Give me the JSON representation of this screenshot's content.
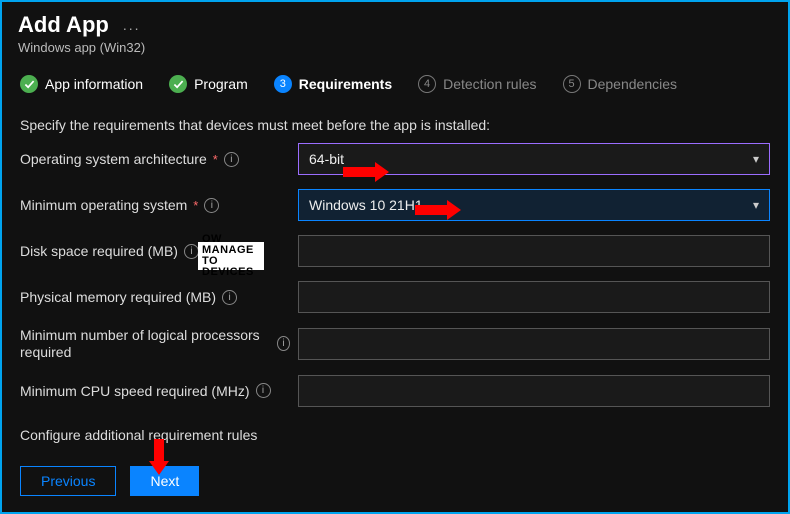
{
  "header": {
    "title": "Add App",
    "more_glyph": "...",
    "subtitle": "Windows app (Win32)"
  },
  "tabs": {
    "t1": {
      "label": "App information"
    },
    "t2": {
      "label": "Program"
    },
    "t3": {
      "label": "Requirements",
      "num": "3"
    },
    "t4": {
      "label": "Detection rules",
      "num": "4"
    },
    "t5": {
      "label": "Dependencies",
      "num": "5"
    }
  },
  "section_desc": "Specify the requirements that devices must meet before the app is installed:",
  "fields": {
    "arch": {
      "label": "Operating system architecture",
      "value": "64-bit"
    },
    "minos": {
      "label": "Minimum operating system",
      "value": "Windows 10 21H1"
    },
    "disk": {
      "label": "Disk space required (MB)"
    },
    "mem": {
      "label": "Physical memory required (MB)"
    },
    "cpu_count": {
      "label": "Minimum number of logical processors required"
    },
    "cpu_speed": {
      "label": "Minimum CPU speed required (MHz)"
    }
  },
  "extra_label": "Configure additional requirement rules",
  "buttons": {
    "prev": "Previous",
    "next": "Next"
  },
  "watermark": {
    "l1": "OW  MANAGE",
    "l2": "TO   DEVICES"
  }
}
